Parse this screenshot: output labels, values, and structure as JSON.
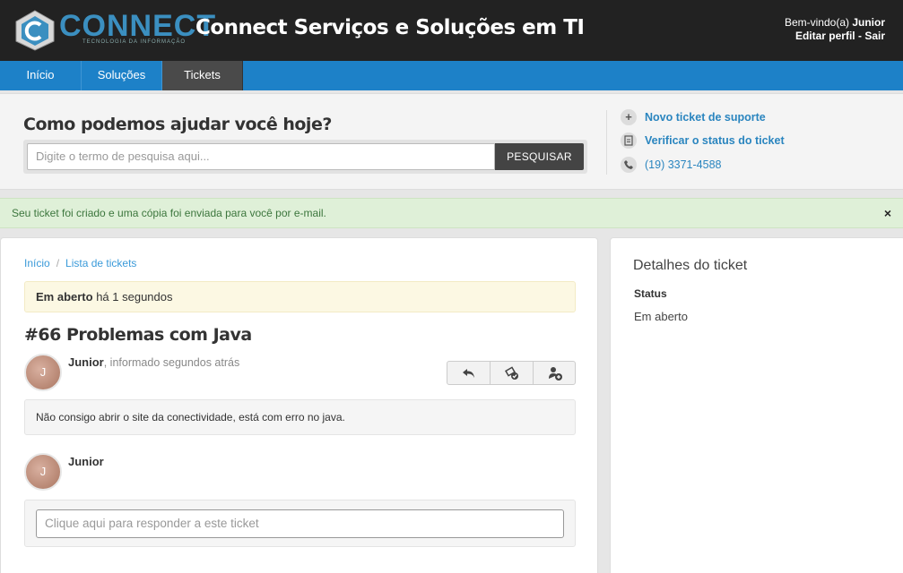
{
  "header": {
    "logo_text": "CONNECT",
    "logo_tagline": "TECNOLOGIA DA INFORMAÇÃO",
    "site_title": "Connect Serviços e Soluções em TI",
    "welcome_prefix": "Bem-vindo(a) ",
    "user_name": "Junior",
    "edit_profile": "Editar perfil",
    "separator": " - ",
    "logout": "Sair"
  },
  "nav": {
    "items": [
      {
        "label": "Início"
      },
      {
        "label": "Soluções"
      },
      {
        "label": "Tickets"
      }
    ],
    "active": "Tickets"
  },
  "search": {
    "title": "Como podemos ajudar você hoje?",
    "placeholder": "Digite o termo de pesquisa aqui...",
    "button": "PESQUISAR"
  },
  "quick_links": {
    "new_ticket": "Novo ticket de suporte",
    "check_status": "Verificar o status do ticket",
    "phone": "(19) 3371-4588"
  },
  "alert": {
    "message": "Seu ticket foi criado e uma cópia foi enviada para você por e-mail.",
    "close": "×"
  },
  "breadcrumb": {
    "home": "Início",
    "separator": "/",
    "list": "Lista de tickets"
  },
  "ticket": {
    "status_label": "Em aberto",
    "status_time": " há 1 segundos",
    "title": "#66 Problemas com Java",
    "author": "Junior",
    "author_meta": ", informado segundos atrás",
    "avatar_initial": "J",
    "message": "Não consigo abrir o site da conectividade, está com erro no java.",
    "reply_author": "Junior",
    "reply_placeholder": "Clique aqui para responder a este ticket"
  },
  "side": {
    "title": "Detalhes do ticket",
    "status_label": "Status",
    "status_value": "Em aberto"
  },
  "icons": {
    "new_ticket": "plus-icon",
    "check_status": "document-icon",
    "phone": "phone-icon",
    "reply": "reply-icon",
    "close_ticket": "ticket-check-icon",
    "assign": "add-user-icon"
  },
  "colors": {
    "header_bg": "#222222",
    "nav_bg": "#1d81c8",
    "nav_active": "#4a4a4a",
    "link": "#2a85bf",
    "alert_bg": "#dff0d8",
    "status_bg": "#fcf8e3"
  }
}
